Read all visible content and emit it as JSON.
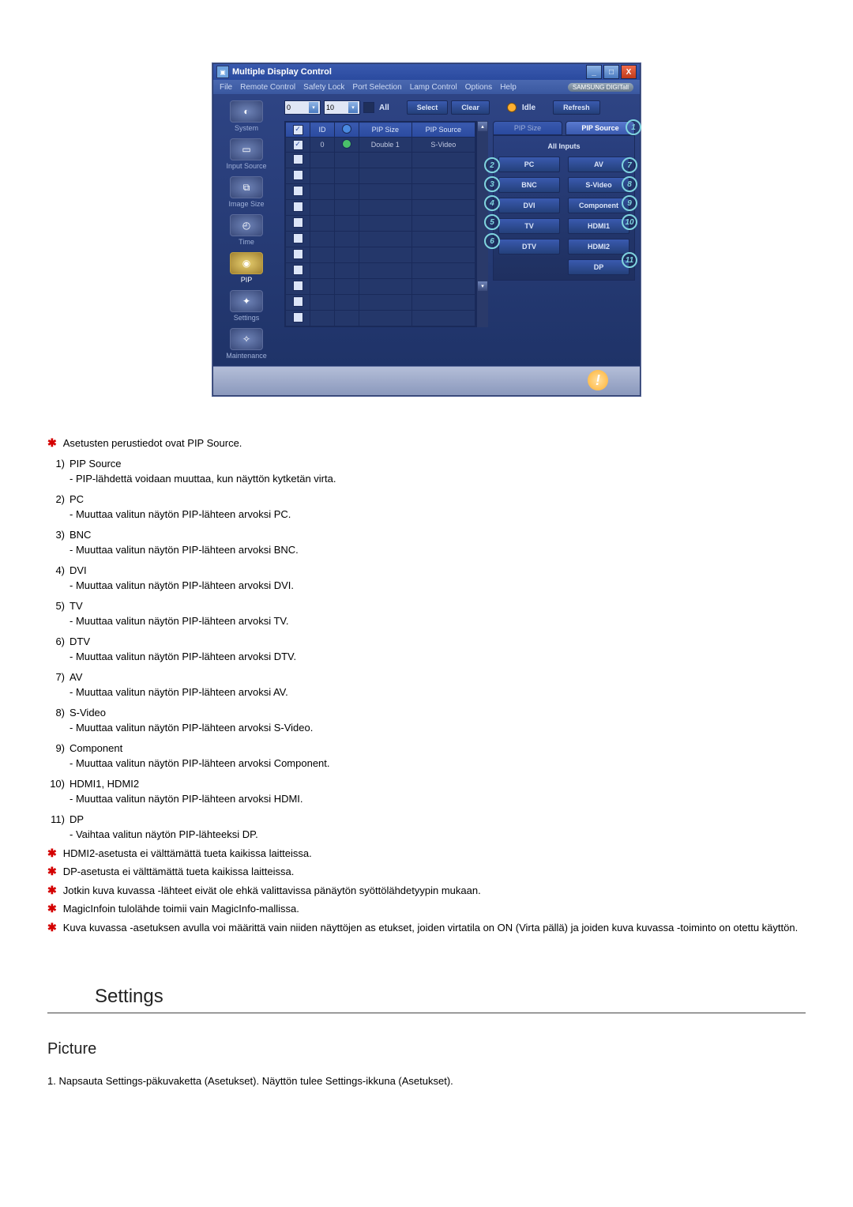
{
  "app": {
    "title": "Multiple Display Control",
    "menu": [
      "File",
      "Remote Control",
      "Safety Lock",
      "Port Selection",
      "Lamp Control",
      "Options",
      "Help"
    ],
    "brand": "SAMSUNG DIGITall"
  },
  "sidebar": {
    "items": [
      {
        "label": "System"
      },
      {
        "label": "Input Source"
      },
      {
        "label": "Image Size"
      },
      {
        "label": "Time"
      },
      {
        "label": "PIP"
      },
      {
        "label": "Settings"
      },
      {
        "label": "Maintenance"
      }
    ],
    "active_index": 4
  },
  "toolbar": {
    "range_from": "0",
    "range_to": "10",
    "all_label": "All",
    "select_label": "Select",
    "clear_label": "Clear",
    "idle_label": "Idle",
    "refresh_label": "Refresh"
  },
  "grid": {
    "headers": {
      "chk": "",
      "id": "ID",
      "status": "",
      "pip_size": "PIP Size",
      "pip_source": "PIP Source"
    },
    "rows": [
      {
        "checked": true,
        "id": "0",
        "status": "green",
        "pip_size": "Double 1",
        "pip_source": "S-Video"
      }
    ],
    "blank_rows": 11
  },
  "panel": {
    "tabs": [
      {
        "label": "PIP Size",
        "active": false
      },
      {
        "label": "PIP Source",
        "active": true
      }
    ],
    "title": "All Inputs",
    "buttons_left": [
      "PC",
      "BNC",
      "DVI",
      "TV",
      "DTV"
    ],
    "buttons_right": [
      "AV",
      "S-Video",
      "Component",
      "HDMI1",
      "HDMI2",
      "DP"
    ]
  },
  "callouts": {
    "tabs_right": "1",
    "left": [
      "2",
      "3",
      "4",
      "5",
      "6"
    ],
    "right": [
      "7",
      "8",
      "9",
      "10",
      "11"
    ]
  },
  "doc": {
    "intro": "Asetusten perustiedot ovat PIP Source.",
    "items": [
      {
        "n": "1)",
        "t": "PIP Source",
        "d": "- PIP-lähdettä voidaan muuttaa,   kun näyttön kytketän virta."
      },
      {
        "n": "2)",
        "t": "PC",
        "d": "- Muuttaa valitun näytön PIP-lähteen arvoksi PC."
      },
      {
        "n": "3)",
        "t": "BNC",
        "d": "- Muuttaa valitun näytön PIP-lähteen arvoksi BNC."
      },
      {
        "n": "4)",
        "t": "DVI",
        "d": "- Muuttaa valitun näytön PIP-lähteen arvoksi DVI."
      },
      {
        "n": "5)",
        "t": "TV",
        "d": "- Muuttaa valitun näytön PIP-lähteen arvoksi TV."
      },
      {
        "n": "6)",
        "t": "DTV",
        "d": "- Muuttaa valitun näytön PIP-lähteen arvoksi DTV."
      },
      {
        "n": "7)",
        "t": "AV",
        "d": "- Muuttaa valitun näytön PIP-lähteen arvoksi AV."
      },
      {
        "n": "8)",
        "t": "S-Video",
        "d": "- Muuttaa valitun näytön PIP-lähteen arvoksi S-Video."
      },
      {
        "n": "9)",
        "t": "Component",
        "d": "- Muuttaa valitun näytön PIP-lähteen arvoksi Component."
      },
      {
        "n": "10)",
        "t": "HDMI1, HDMI2",
        "d": "- Muuttaa valitun näytön PIP-lähteen arvoksi HDMI."
      },
      {
        "n": "11)",
        "t": "DP",
        "d": "- Vaihtaa valitun näytön PIP-lähteeksi DP."
      }
    ],
    "notes": [
      "HDMI2-asetusta ei välttämättä tueta kaikissa laitteissa.",
      "DP-asetusta ei välttämättä tueta kaikissa laitteissa.",
      "Jotkin kuva kuvassa -lähteet eivät ole ehkä               valittavissa pänäytön syöttölähdetyypin mukaan.",
      "MagicInfoin tulolähde toimii vain MagicInfo-mallissa.",
      "Kuva kuvassa -asetuksen avulla voi        määrittä vain niiden näyttöjen as            etukset, joiden virtatila on ON (Virta pällä) ja joiden kuva kuvassa -toiminto on otettu käyttön."
    ],
    "section": "Settings",
    "subsection": "Picture",
    "sub_item": "1.  Napsauta Settings-päkuvaketta (Asetukset). Näyttön tulee Settings-ikkuna (Asetukset)."
  }
}
